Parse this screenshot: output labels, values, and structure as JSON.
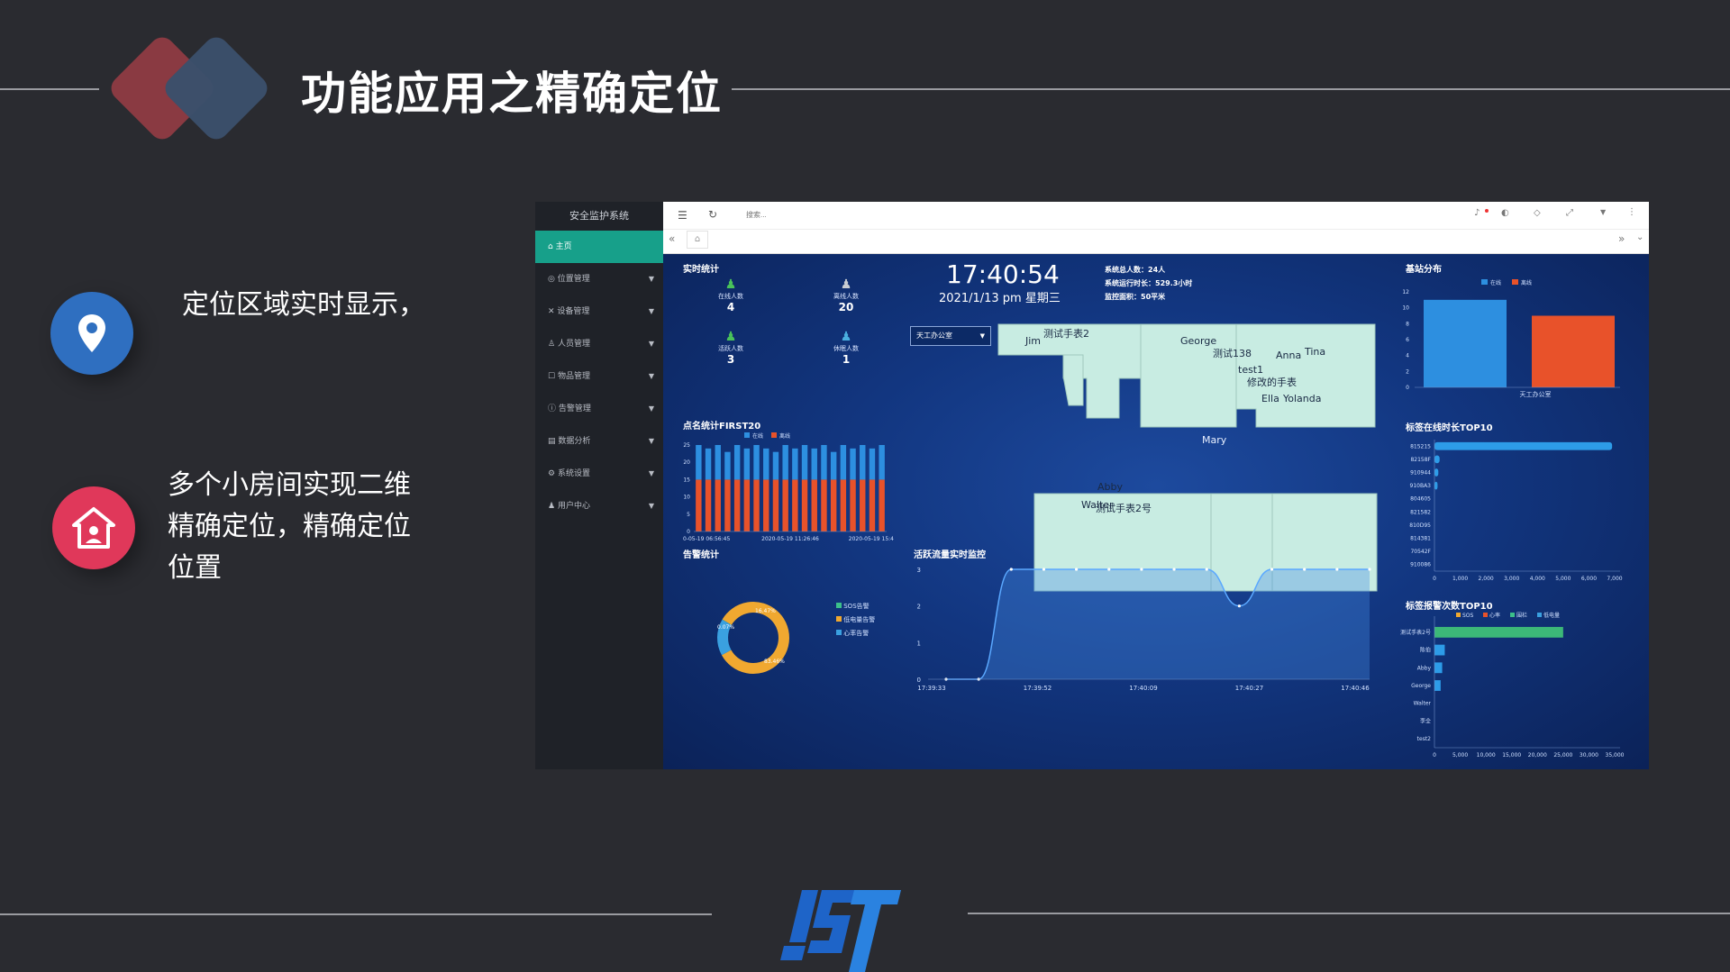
{
  "slide": {
    "title": "功能应用之精确定位",
    "bullets": [
      {
        "text": "定位区域实时显示，",
        "icon": "location-pin-icon"
      },
      {
        "text_lines": [
          "多个小房间实现二维",
          "精确定位，精确定位",
          "位置"
        ],
        "icon": "home-icon"
      }
    ],
    "logo_text": "IST",
    "colors": {
      "accent_red": "#e0385a",
      "accent_blue": "#2f6fc0",
      "diamond_red": "#8a3a42",
      "diamond_blue": "#3b4f6b"
    }
  },
  "app": {
    "sidebar": {
      "brand": "安全监护系统",
      "items": [
        {
          "label": "主页",
          "active": true
        },
        {
          "label": "位置管理"
        },
        {
          "label": "设备管理"
        },
        {
          "label": "人员管理"
        },
        {
          "label": "物品管理"
        },
        {
          "label": "告警管理"
        },
        {
          "label": "数据分析"
        },
        {
          "label": "系统设置"
        },
        {
          "label": "用户中心"
        }
      ]
    },
    "topbar": {
      "search_placeholder": "搜索..."
    },
    "clock": {
      "time": "17:40:54",
      "date": "2021/1/13 pm 星期三"
    },
    "system_info": [
      "系统总人数：24人",
      "系统运行时长：529.3小时",
      "监控面积：50平米"
    ],
    "realtime_stats": {
      "title": "实时统计",
      "items": [
        {
          "label": "在线人数",
          "value": "4"
        },
        {
          "label": "离线人数",
          "value": "20"
        },
        {
          "label": "活跃人数",
          "value": "3"
        },
        {
          "label": "休眠人数",
          "value": "1"
        }
      ]
    },
    "area_select": {
      "value": "天工办公室"
    },
    "map_labels": [
      "Jim",
      "测试手表2",
      "George",
      "测试138",
      "test1",
      "修改的手表",
      "Anna",
      "Tina",
      "Ella",
      "Yolanda",
      "Mary",
      "Abby",
      "Walter",
      "测试手表2号"
    ],
    "alarm_stats": {
      "title": "告警统计",
      "legend": [
        "SOS告警",
        "低电量告警",
        "心率告警"
      ]
    },
    "base_station": {
      "title": "基站分布",
      "legend": [
        "在线",
        "离线"
      ]
    },
    "tag_online_top10": {
      "title": "标签在线时长TOP10"
    },
    "tag_alarm_top10": {
      "title": "标签报警次数TOP10",
      "legend": [
        "SOS",
        "心率",
        "围栏",
        "低电量"
      ]
    },
    "activity_monitor": {
      "title": "活跃流量实时监控"
    }
  },
  "chart_data": [
    {
      "type": "bar",
      "title": "点名统计FIRST20",
      "legend": [
        "在线",
        "离线"
      ],
      "categories": [
        "0-05-19 06:56:45",
        "",
        "",
        "",
        "",
        "",
        "",
        "",
        "",
        "",
        "2020-05-19 11:26:46",
        "",
        "",
        "",
        "",
        "",
        "",
        "",
        "",
        "2020-05-19 15:4"
      ],
      "series": [
        {
          "name": "离线",
          "values": [
            15,
            15,
            15,
            15,
            15,
            15,
            15,
            15,
            15,
            15,
            15,
            15,
            15,
            15,
            15,
            15,
            15,
            15,
            15,
            15
          ]
        },
        {
          "name": "在线",
          "values": [
            10,
            9,
            10,
            8,
            10,
            9,
            10,
            9,
            8,
            10,
            9,
            10,
            9,
            10,
            8,
            10,
            9,
            10,
            9,
            10
          ]
        }
      ],
      "stacked": true,
      "ylim": [
        0,
        25
      ],
      "yticks": [
        0,
        5,
        10,
        15,
        20,
        25
      ]
    },
    {
      "type": "pie",
      "title": "告警统计",
      "labels": [
        "SOS告警",
        "低电量告警",
        "心率告警"
      ],
      "values": [
        83.46,
        16.47,
        0.07
      ],
      "slice_labels": [
        "83.46%",
        "16.47%",
        "0.07%"
      ]
    },
    {
      "type": "line",
      "title": "活跃流量实时监控",
      "x_ticks": [
        "17:39:33",
        "17:39:52",
        "17:40:09",
        "17:40:27",
        "17:40:46"
      ],
      "values": [
        0,
        0,
        3,
        3,
        3,
        3,
        3,
        3,
        3,
        2,
        3,
        3,
        3,
        3
      ],
      "ylim": [
        0,
        3
      ],
      "yticks": [
        0,
        1,
        2,
        3
      ]
    },
    {
      "type": "bar",
      "title": "基站分布",
      "categories": [
        "天工办公室"
      ],
      "series": [
        {
          "name": "在线",
          "values": [
            11
          ]
        },
        {
          "name": "离线",
          "values": [
            9
          ]
        }
      ],
      "ylim": [
        0,
        12
      ],
      "yticks": [
        0,
        2,
        4,
        6,
        8,
        10,
        12
      ]
    },
    {
      "type": "bar",
      "orientation": "horizontal",
      "title": "标签在线时长TOP10",
      "categories": [
        "815215",
        "82158F",
        "910944",
        "910BA3",
        "804605",
        "821582",
        "810D95",
        "814381",
        "70542F",
        "910086"
      ],
      "values": [
        6900,
        200,
        150,
        120,
        0,
        0,
        0,
        0,
        0,
        0
      ],
      "xlim": [
        0,
        7000
      ],
      "xticks": [
        "0",
        "1,000",
        "2,000",
        "3,000",
        "4,000",
        "5,000",
        "6,000",
        "7,000"
      ]
    },
    {
      "type": "bar",
      "orientation": "horizontal",
      "title": "标签报警次数TOP10",
      "categories": [
        "测试手表2号",
        "陈伯",
        "Abby",
        "George",
        "Walter",
        "李全",
        "test2"
      ],
      "values": [
        25000,
        2000,
        1500,
        1200,
        0,
        0,
        0
      ],
      "xlim": [
        0,
        35000
      ],
      "xticks": [
        "0",
        "5,000",
        "10,000",
        "15,000",
        "20,000",
        "25,000",
        "30,000",
        "35,000"
      ]
    }
  ]
}
